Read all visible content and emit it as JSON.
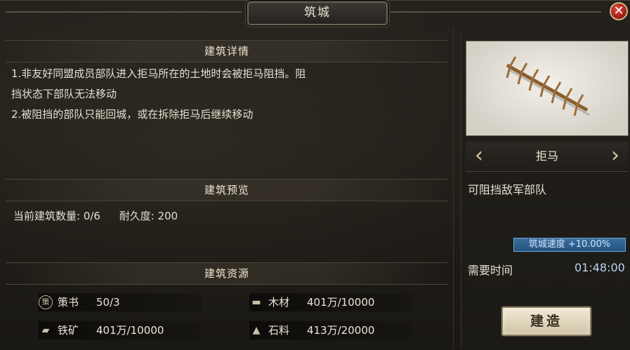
{
  "window": {
    "title": "筑城",
    "close_symbol": "✕"
  },
  "details": {
    "header": "建筑详情",
    "lines": [
      "1.非友好同盟成员部队进入拒马所在的土地时会被拒马阻挡。阻",
      "挡状态下部队无法移动",
      "2.被阻挡的部队只能回城，或在拆除拒马后继续移动"
    ]
  },
  "preview": {
    "header": "建筑预览",
    "count_text": "当前建筑数量: 0/6",
    "durability_text": "耐久度: 200"
  },
  "resources": {
    "header": "建筑资源",
    "items": [
      {
        "icon": "book-icon",
        "name": "策书",
        "value": "50/3"
      },
      {
        "icon": "wood-icon",
        "name": "木材",
        "value": "401万/10000"
      },
      {
        "icon": "iron-icon",
        "name": "铁矿",
        "value": "401万/10000"
      },
      {
        "icon": "stone-icon",
        "name": "石料",
        "value": "413万/20000"
      }
    ]
  },
  "building": {
    "name": "拒马",
    "effect": "可阻挡敌军部队",
    "speed_badge": "筑城速度 +10.00%",
    "time_label": "需要时间",
    "time_value": "01:48:00",
    "build_button": "建造"
  },
  "colors": {
    "accent_blue": "#2e6290",
    "button_bg": "#e8dfc8",
    "close_red": "#c42a1e"
  }
}
